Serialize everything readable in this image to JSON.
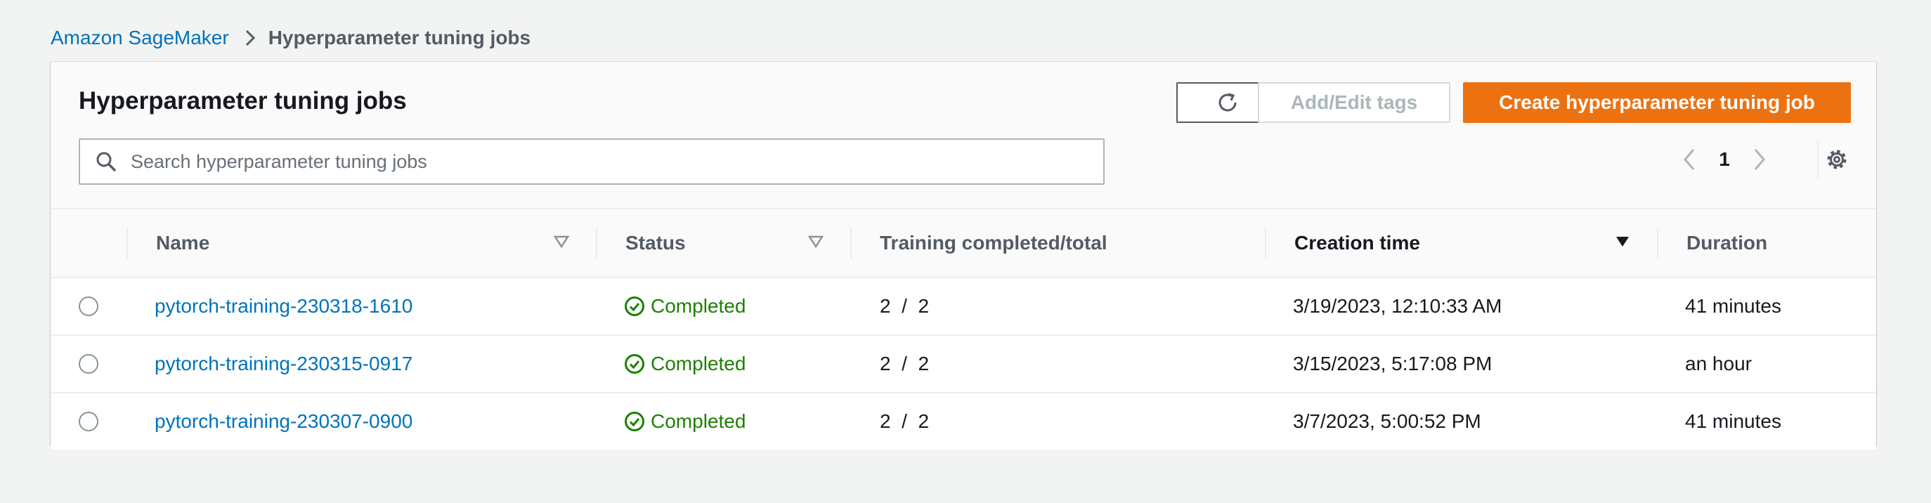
{
  "breadcrumb": {
    "root": "Amazon SageMaker",
    "current": "Hyperparameter tuning jobs"
  },
  "panel": {
    "title": "Hyperparameter tuning jobs",
    "buttons": {
      "refresh_icon": "refresh-icon",
      "add_edit_tags": "Add/Edit tags",
      "create": "Create hyperparameter tuning job"
    },
    "search": {
      "placeholder": "Search hyperparameter tuning jobs",
      "value": ""
    },
    "pagination": {
      "current_page": "1"
    }
  },
  "table": {
    "columns": [
      {
        "label": "Name"
      },
      {
        "label": "Status"
      },
      {
        "label": "Training completed/total"
      },
      {
        "label": "Creation time"
      },
      {
        "label": "Duration"
      }
    ],
    "rows": [
      {
        "name": "pytorch-training-230318-1610",
        "status": "Completed",
        "training": "2  /  2",
        "created": "3/19/2023, 12:10:33 AM",
        "duration": "41 minutes"
      },
      {
        "name": "pytorch-training-230315-0917",
        "status": "Completed",
        "training": "2  /  2",
        "created": "3/15/2023, 5:17:08 PM",
        "duration": "an hour"
      },
      {
        "name": "pytorch-training-230307-0900",
        "status": "Completed",
        "training": "2  /  2",
        "created": "3/7/2023, 5:00:52 PM",
        "duration": "41 minutes"
      }
    ]
  },
  "colors": {
    "link": "#0073bb",
    "primary_button": "#ec7211",
    "success": "#1d8102",
    "background": "#f2f3f3"
  }
}
